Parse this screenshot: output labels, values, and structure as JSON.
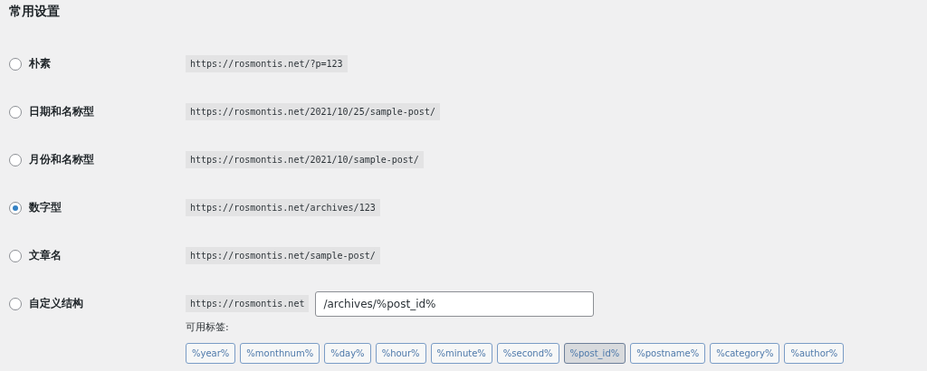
{
  "heading": "常用设置",
  "options": [
    {
      "label": "朴素",
      "example": "https://rosmontis.net/?p=123",
      "selected": false
    },
    {
      "label": "日期和名称型",
      "example": "https://rosmontis.net/2021/10/25/sample-post/",
      "selected": false
    },
    {
      "label": "月份和名称型",
      "example": "https://rosmontis.net/2021/10/sample-post/",
      "selected": false
    },
    {
      "label": "数字型",
      "example": "https://rosmontis.net/archives/123",
      "selected": true
    },
    {
      "label": "文章名",
      "example": "https://rosmontis.net/sample-post/",
      "selected": false
    },
    {
      "label": "自定义结构",
      "example": "https://rosmontis.net",
      "selected": false
    }
  ],
  "custom_structure": {
    "value": "/archives/%post_id%"
  },
  "tags_label": "可用标签:",
  "tags": [
    {
      "label": "%year%",
      "selected": false
    },
    {
      "label": "%monthnum%",
      "selected": false
    },
    {
      "label": "%day%",
      "selected": false
    },
    {
      "label": "%hour%",
      "selected": false
    },
    {
      "label": "%minute%",
      "selected": false
    },
    {
      "label": "%second%",
      "selected": false
    },
    {
      "label": "%post_id%",
      "selected": true
    },
    {
      "label": "%postname%",
      "selected": false
    },
    {
      "label": "%category%",
      "selected": false
    },
    {
      "label": "%author%",
      "selected": false
    }
  ]
}
